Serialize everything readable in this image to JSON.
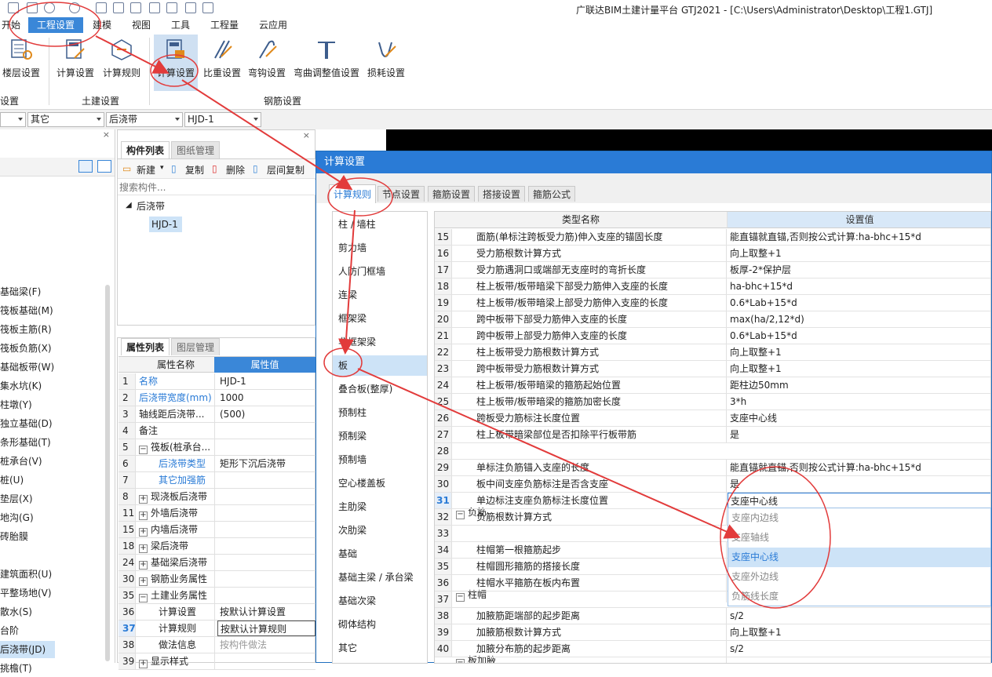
{
  "app": {
    "title": "广联达BIM土建计量平台 GTJ2021 - [C:\\Users\\Administrator\\Desktop\\工程1.GTJ]"
  },
  "menu": [
    "开始",
    "工程设置",
    "建模",
    "视图",
    "工具",
    "工程量",
    "云应用"
  ],
  "ribbon": {
    "buttons": [
      "楼层设置",
      "计算设置",
      "计算规则",
      "计算设置",
      "比重设置",
      "弯钩设置",
      "弯曲调整值设置",
      "损耗设置"
    ],
    "groups": [
      "设置",
      "土建设置",
      "钢筋设置"
    ]
  },
  "combos": [
    "",
    "其它",
    "后浇带",
    "HJD-1"
  ],
  "leftnav": {
    "items": [
      "基础梁(F)",
      "筏板基础(M)",
      "筏板主筋(R)",
      "筏板负筋(X)",
      "基础板带(W)",
      "集水坑(K)",
      "柱墩(Y)",
      "独立基础(D)",
      "条形基础(T)",
      "桩承台(V)",
      "桩(U)",
      "垫层(X)",
      "地沟(G)",
      "砖胎膜",
      "建筑面积(U)",
      "平整场地(V)",
      "散水(S)",
      "台阶",
      "后浇带(JD)",
      "挑檐(T)"
    ]
  },
  "comp": {
    "tabs": [
      "构件列表",
      "图纸管理"
    ],
    "toolbar": [
      "新建",
      "复制",
      "删除",
      "层间复制"
    ],
    "search_placeholder": "搜索构件...",
    "tree_parent": "后浇带",
    "tree_child": "HJD-1"
  },
  "prop": {
    "tabs": [
      "属性列表",
      "图层管理"
    ],
    "header": [
      "属性名称",
      "属性值"
    ],
    "rows": [
      {
        "n": "1",
        "k": "名称",
        "v": "HJD-1",
        "blue": true
      },
      {
        "n": "2",
        "k": "后浇带宽度(mm)",
        "v": "1000",
        "blue": true
      },
      {
        "n": "3",
        "k": "轴线距后浇带...",
        "v": "(500)"
      },
      {
        "n": "4",
        "k": "备注",
        "v": ""
      },
      {
        "n": "5",
        "k": "筏板(桩承台...",
        "v": "",
        "tog": "−"
      },
      {
        "n": "6",
        "k": "后浇带类型",
        "v": "矩形下沉后浇带",
        "blue": true,
        "indent": true
      },
      {
        "n": "7",
        "k": "其它加强筋",
        "v": "",
        "blue": true,
        "indent": true
      },
      {
        "n": "8",
        "k": "现浇板后浇带",
        "v": "",
        "tog": "+"
      },
      {
        "n": "11",
        "k": "外墙后浇带",
        "v": "",
        "tog": "+"
      },
      {
        "n": "15",
        "k": "内墙后浇带",
        "v": "",
        "tog": "+"
      },
      {
        "n": "18",
        "k": "梁后浇带",
        "v": "",
        "tog": "+"
      },
      {
        "n": "24",
        "k": "基础梁后浇带",
        "v": "",
        "tog": "+"
      },
      {
        "n": "30",
        "k": "钢筋业务属性",
        "v": "",
        "tog": "+"
      },
      {
        "n": "35",
        "k": "土建业务属性",
        "v": "",
        "tog": "−"
      },
      {
        "n": "36",
        "k": "计算设置",
        "v": "按默认计算设置",
        "indent": true
      },
      {
        "n": "37",
        "k": "计算规则",
        "v": "按默认计算规则",
        "indent": true,
        "cur": true
      },
      {
        "n": "38",
        "k": "做法信息",
        "v": "按构件做法",
        "indent": true,
        "grey": true
      },
      {
        "n": "39",
        "k": "显示样式",
        "v": "",
        "tog": "+"
      }
    ]
  },
  "dialog": {
    "title": "计算设置",
    "tabs": [
      "计算规则",
      "节点设置",
      "箍筋设置",
      "搭接设置",
      "箍筋公式"
    ],
    "categories": [
      "柱 / 墙柱",
      "剪力墙",
      "人防门框墙",
      "连梁",
      "框架梁",
      "非框架梁",
      "板",
      "叠合板(整厚)",
      "预制柱",
      "预制梁",
      "预制墙",
      "空心楼盖板",
      "主肋梁",
      "次肋梁",
      "基础",
      "基础主梁 / 承台梁",
      "基础次梁",
      "砌体结构",
      "其它"
    ],
    "grid_header": [
      "类型名称",
      "设置值"
    ],
    "rows": [
      {
        "n": "15",
        "k": "面筋(单标注跨板受力筋)伸入支座的锚固长度",
        "v": "能直锚就直锚,否则按公式计算:ha-bhc+15*d"
      },
      {
        "n": "16",
        "k": "受力筋根数计算方式",
        "v": "向上取整+1"
      },
      {
        "n": "17",
        "k": "受力筋遇洞口或端部无支座时的弯折长度",
        "v": "板厚-2*保护层"
      },
      {
        "n": "18",
        "k": "柱上板带/板带暗梁下部受力筋伸入支座的长度",
        "v": "ha-bhc+15*d"
      },
      {
        "n": "19",
        "k": "柱上板带/板带暗梁上部受力筋伸入支座的长度",
        "v": "0.6*Lab+15*d"
      },
      {
        "n": "20",
        "k": "跨中板带下部受力筋伸入支座的长度",
        "v": "max(ha/2,12*d)"
      },
      {
        "n": "21",
        "k": "跨中板带上部受力筋伸入支座的长度",
        "v": "0.6*Lab+15*d"
      },
      {
        "n": "22",
        "k": "柱上板带受力筋根数计算方式",
        "v": "向上取整+1"
      },
      {
        "n": "23",
        "k": "跨中板带受力筋根数计算方式",
        "v": "向上取整+1"
      },
      {
        "n": "24",
        "k": "柱上板带/板带暗梁的箍筋起始位置",
        "v": "距柱边50mm"
      },
      {
        "n": "25",
        "k": "柱上板带/板带暗梁的箍筋加密长度",
        "v": "3*h"
      },
      {
        "n": "26",
        "k": "跨板受力筋标注长度位置",
        "v": "支座中心线"
      },
      {
        "n": "27",
        "k": "柱上板带暗梁部位是否扣除平行板带筋",
        "v": "是"
      },
      {
        "n": "28",
        "k": "负筋",
        "v": "",
        "grp": true
      },
      {
        "n": "29",
        "k": "单标注负筋锚入支座的长度",
        "v": "能直锚就直锚,否则按公式计算:ha-bhc+15*d"
      },
      {
        "n": "30",
        "k": "板中间支座负筋标注是否含支座",
        "v": "是"
      },
      {
        "n": "31",
        "k": "单边标注支座负筋标注长度位置",
        "v": "支座中心线",
        "cur": true
      },
      {
        "n": "32",
        "k": "负筋根数计算方式",
        "v": ""
      },
      {
        "n": "33",
        "k": "柱帽",
        "v": "",
        "grp": true
      },
      {
        "n": "34",
        "k": "柱帽第一根箍筋起步",
        "v": ""
      },
      {
        "n": "35",
        "k": "柱帽圆形箍筋的搭接长度",
        "v": ""
      },
      {
        "n": "36",
        "k": "柱帽水平箍筋在板内布置",
        "v": ""
      },
      {
        "n": "37",
        "k": "板加腋",
        "v": "",
        "grp": true
      },
      {
        "n": "38",
        "k": "加腋筋距端部的起步距离",
        "v": "s/2"
      },
      {
        "n": "39",
        "k": "加腋筋根数计算方式",
        "v": "向上取整+1"
      },
      {
        "n": "40",
        "k": "加腋分布筋的起步距离",
        "v": "s/2"
      }
    ],
    "dropdown": [
      "支座内边线",
      "支座轴线",
      "支座中心线",
      "支座外边线",
      "负筋线长度"
    ],
    "dropdown_selected": 2
  },
  "colors": {
    "accent": "#2a7bd6",
    "annotation": "#e23b3b",
    "selection": "#cde3f7"
  }
}
